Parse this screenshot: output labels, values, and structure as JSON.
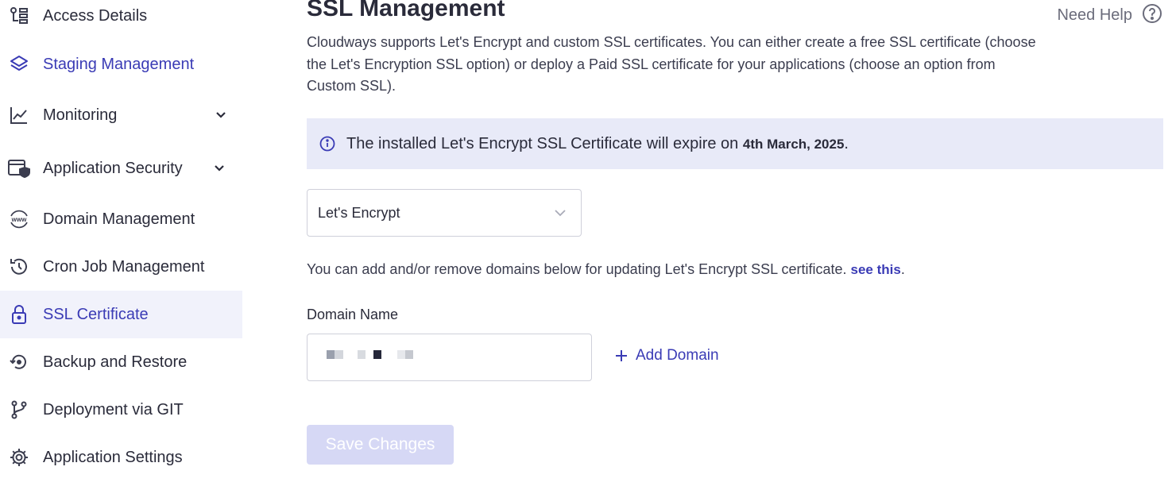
{
  "sidebar": {
    "items": [
      {
        "label": "Access Details",
        "icon": "access-details-icon"
      },
      {
        "label": "Staging Management",
        "icon": "layers-icon"
      },
      {
        "label": "Monitoring",
        "icon": "chart-line-icon"
      },
      {
        "label": "Application Security",
        "icon": "shield-window-icon"
      },
      {
        "label": "Domain Management",
        "icon": "www-globe-icon"
      },
      {
        "label": "Cron Job Management",
        "icon": "history-icon"
      },
      {
        "label": "SSL Certificate",
        "icon": "lock-icon"
      },
      {
        "label": "Backup and Restore",
        "icon": "restore-icon"
      },
      {
        "label": "Deployment via GIT",
        "icon": "git-branch-icon"
      },
      {
        "label": "Application Settings",
        "icon": "gear-icon"
      }
    ],
    "active_index": 6
  },
  "header": {
    "title": "SSL Management",
    "help_label": "Need Help"
  },
  "description": "Cloudways supports Let's Encrypt and custom SSL certificates. You can either create a free SSL certificate (choose the Let's Encryption SSL option) or deploy a Paid SSL certificate for your applications (choose an option from Custom SSL).",
  "alert": {
    "text": "The installed Let's Encrypt SSL Certificate will expire on ",
    "date": "4th March, 2025",
    "suffix": "."
  },
  "ssl_type": {
    "selected": "Let's Encrypt"
  },
  "domain_info": {
    "text": "You can add and/or remove domains below for updating Let's Encrypt SSL certificate. ",
    "link": "see this",
    "suffix": "."
  },
  "domain": {
    "label": "Domain Name",
    "value": ""
  },
  "add_domain_label": "Add Domain",
  "save_label": "Save Changes",
  "colors": {
    "accent": "#3a3bb5",
    "alert_bg": "#e8eaf8",
    "active_bg": "#f1f2fb",
    "disabled_button": "#d6d8f5"
  }
}
